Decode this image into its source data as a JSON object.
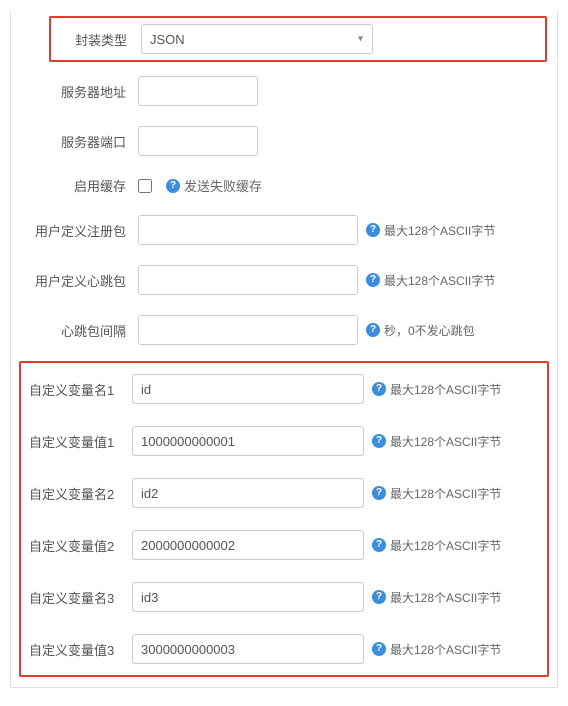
{
  "encapsulation": {
    "label": "封装类型",
    "value": "JSON"
  },
  "server_address": {
    "label": "服务器地址",
    "value": ""
  },
  "server_port": {
    "label": "服务器端口",
    "value": ""
  },
  "enable_cache": {
    "label": "启用缓存",
    "checked": false,
    "hint": "发送失败缓存"
  },
  "register_packet": {
    "label": "用户定义注册包",
    "value": "",
    "hint": "最大128个ASCII字节"
  },
  "heartbeat_packet": {
    "label": "用户定义心跳包",
    "value": "",
    "hint": "最大128个ASCII字节"
  },
  "heartbeat_interval": {
    "label": "心跳包间隔",
    "value": "",
    "hint": "秒，0不发心跳包"
  },
  "custom_vars": [
    {
      "label": "自定义变量名1",
      "value": "id",
      "hint": "最大128个ASCII字节"
    },
    {
      "label": "自定义变量值1",
      "value": "1000000000001",
      "hint": "最大128个ASCII字节"
    },
    {
      "label": "自定义变量名2",
      "value": "id2",
      "hint": "最大128个ASCII字节"
    },
    {
      "label": "自定义变量值2",
      "value": "2000000000002",
      "hint": "最大128个ASCII字节"
    },
    {
      "label": "自定义变量名3",
      "value": "id3",
      "hint": "最大128个ASCII字节"
    },
    {
      "label": "自定义变量值3",
      "value": "3000000000003",
      "hint": "最大128个ASCII字节"
    }
  ]
}
